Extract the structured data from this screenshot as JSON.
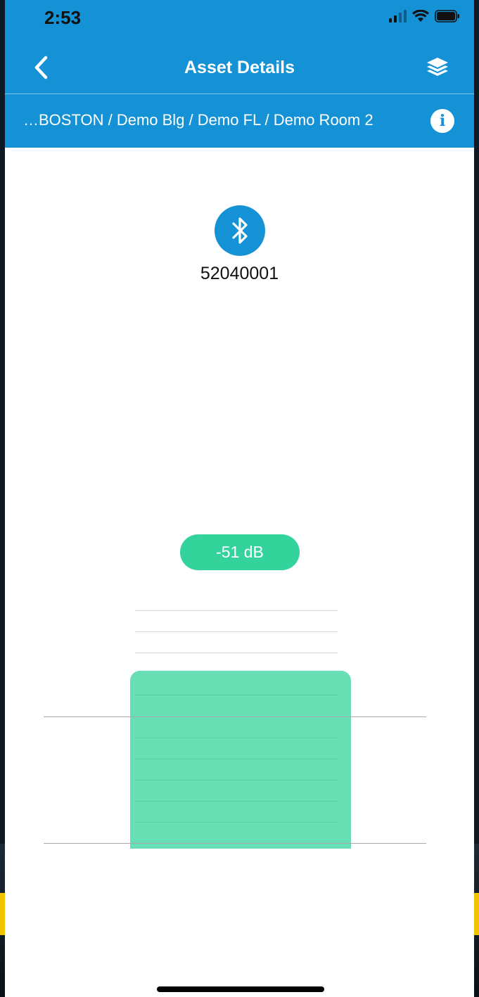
{
  "status_bar": {
    "time": "2:53"
  },
  "header": {
    "title": "Asset Details",
    "breadcrumb": "…BOSTON / Demo Blg / Demo FL / Demo Room 2",
    "icons": {
      "back": "chevron-left-icon",
      "layers": "layers-icon",
      "info": "info-icon"
    },
    "color": "#1591d6"
  },
  "asset": {
    "icon": "bluetooth-icon",
    "id": "52040001"
  },
  "signal": {
    "strength_label": "-51 dB",
    "level": 0.55,
    "color": "#35d39c"
  }
}
